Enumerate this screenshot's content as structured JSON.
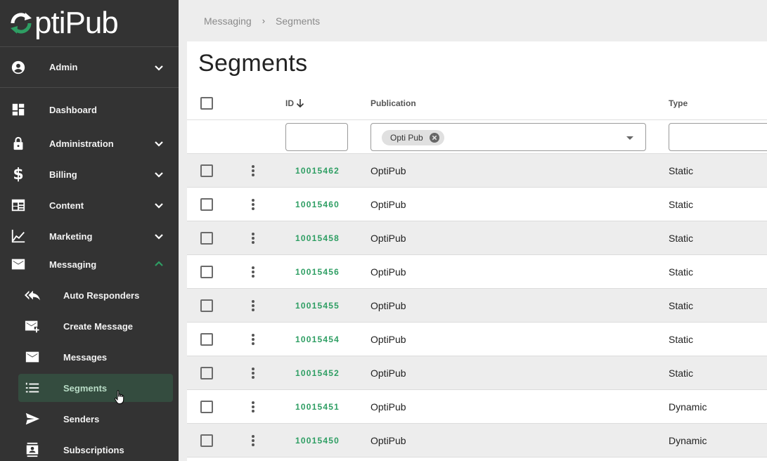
{
  "app": {
    "logo_text": "ptiPub",
    "brand_color": "#2e9e63"
  },
  "sidebar": {
    "user": {
      "label": "Admin",
      "icon": "account-circle-icon"
    },
    "items": [
      {
        "label": "Dashboard",
        "icon": "dashboard-icon",
        "expandable": false
      },
      {
        "label": "Administration",
        "icon": "lock-icon",
        "expandable": true,
        "expanded": false
      },
      {
        "label": "Billing",
        "icon": "dollar-icon",
        "expandable": true,
        "expanded": false
      },
      {
        "label": "Content",
        "icon": "calendar-table-icon",
        "expandable": true,
        "expanded": false
      },
      {
        "label": "Marketing",
        "icon": "chart-line-icon",
        "expandable": true,
        "expanded": false
      },
      {
        "label": "Messaging",
        "icon": "mail-icon",
        "expandable": true,
        "expanded": true
      }
    ],
    "sub_items": [
      {
        "label": "Auto Responders",
        "icon": "reply-all-icon"
      },
      {
        "label": "Create Message",
        "icon": "mail-plus-icon"
      },
      {
        "label": "Messages",
        "icon": "mail-icon"
      },
      {
        "label": "Segments",
        "icon": "numbered-list-icon",
        "active": true
      },
      {
        "label": "Senders",
        "icon": "send-icon"
      },
      {
        "label": "Subscriptions",
        "icon": "contacts-icon"
      }
    ]
  },
  "breadcrumb": {
    "items": [
      "Messaging",
      "Segments"
    ],
    "separator": "›"
  },
  "page": {
    "title": "Segments"
  },
  "table": {
    "columns": {
      "id": "ID",
      "id_sort": "descending",
      "publication": "Publication",
      "type": "Type"
    },
    "filters": {
      "id_value": "",
      "publication_chip": "Opti Pub",
      "type_value": ""
    },
    "rows": [
      {
        "id": "10015462",
        "publication": "OptiPub",
        "type": "Static"
      },
      {
        "id": "10015460",
        "publication": "OptiPub",
        "type": "Static"
      },
      {
        "id": "10015458",
        "publication": "OptiPub",
        "type": "Static"
      },
      {
        "id": "10015456",
        "publication": "OptiPub",
        "type": "Static"
      },
      {
        "id": "10015455",
        "publication": "OptiPub",
        "type": "Static"
      },
      {
        "id": "10015454",
        "publication": "OptiPub",
        "type": "Static"
      },
      {
        "id": "10015452",
        "publication": "OptiPub",
        "type": "Static"
      },
      {
        "id": "10015451",
        "publication": "OptiPub",
        "type": "Dynamic"
      },
      {
        "id": "10015450",
        "publication": "OptiPub",
        "type": "Dynamic"
      }
    ]
  }
}
